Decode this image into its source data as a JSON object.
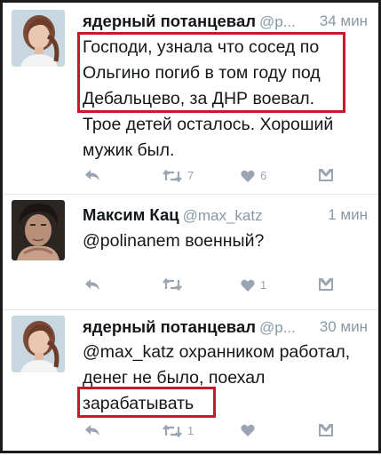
{
  "tweets": [
    {
      "name": "ядерный потанцевал",
      "handle": "@p...",
      "time": "34 мин",
      "lines": [
        "Господи, узнала что сосед по",
        "Ольгино погиб в том году под",
        "Дебальцево, за ДНР воевал.",
        "Трое детей осталось. Хороший",
        "мужик был."
      ],
      "retweets": "7",
      "likes": "6"
    },
    {
      "name": "Максим Кац",
      "handle": "@max_katz",
      "time": "1 мин",
      "lines": [
        "@polinanem военный?"
      ],
      "retweets": "",
      "likes": "1"
    },
    {
      "name": "ядерный потанцевал",
      "handle": "@p...",
      "time": "30 мин",
      "lines": [
        "@max_katz охранником работал,",
        "денег не было, поехал",
        "зарабатывать"
      ],
      "retweets": "1",
      "likes": ""
    }
  ],
  "icons": {
    "reply": "reply-icon",
    "retweet": "retweet-icon",
    "like": "heart-icon",
    "dm": "direct-message-icon"
  },
  "colors": {
    "highlight": "#c8192b",
    "icon": "#9aa5b1",
    "muted_text": "#8899a6"
  }
}
